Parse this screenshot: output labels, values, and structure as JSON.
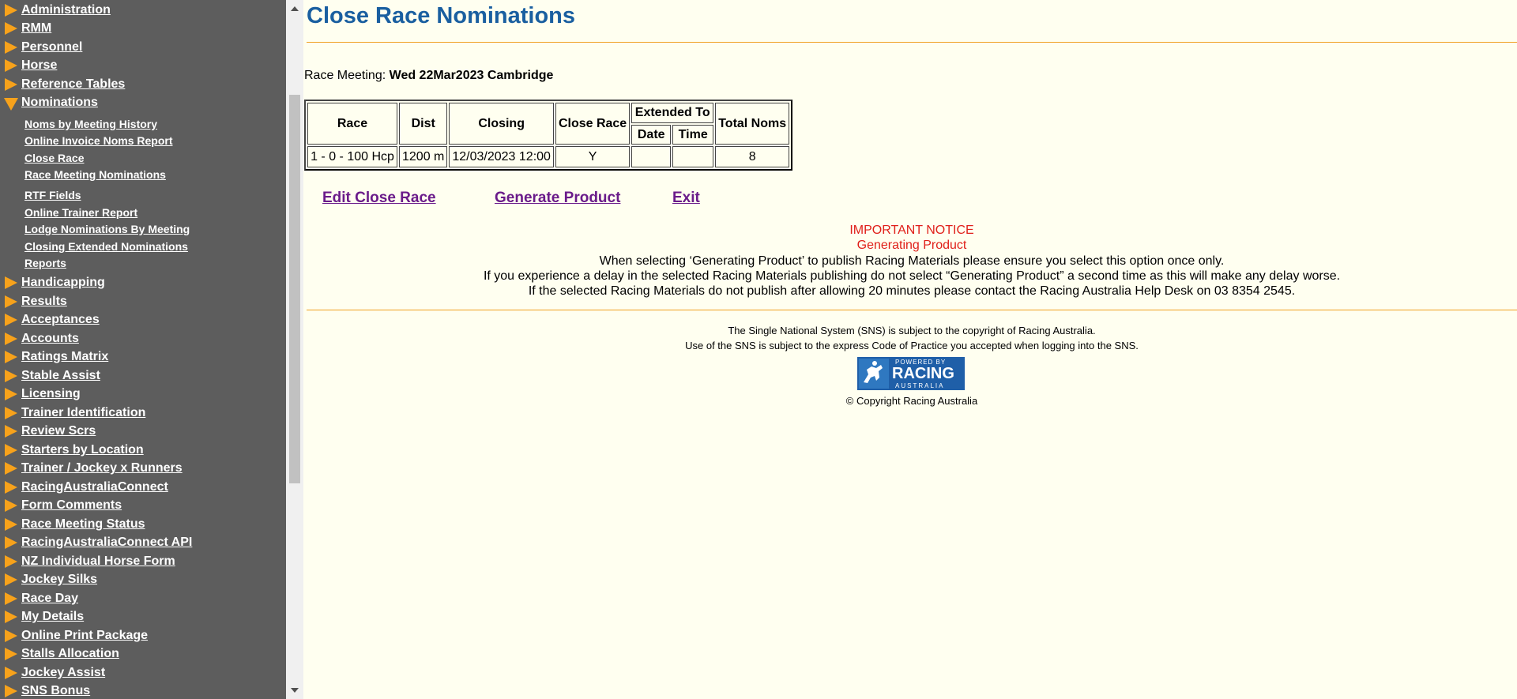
{
  "sidebar": {
    "items": [
      {
        "label": "Administration"
      },
      {
        "label": "RMM"
      },
      {
        "label": "Personnel"
      },
      {
        "label": "Horse"
      },
      {
        "label": "Reference Tables"
      },
      {
        "label": "Nominations"
      },
      {
        "label": "Handicapping"
      },
      {
        "label": "Results"
      },
      {
        "label": "Acceptances"
      },
      {
        "label": "Accounts"
      },
      {
        "label": "Ratings Matrix"
      },
      {
        "label": "Stable Assist"
      },
      {
        "label": "Licensing"
      },
      {
        "label": "Trainer Identification"
      },
      {
        "label": "Review Scrs"
      },
      {
        "label": "Starters by Location"
      },
      {
        "label": "Trainer / Jockey x Runners"
      },
      {
        "label": "RacingAustraliaConnect"
      },
      {
        "label": "Form Comments"
      },
      {
        "label": "Race Meeting Status"
      },
      {
        "label": "RacingAustraliaConnect API"
      },
      {
        "label": "NZ Individual Horse Form"
      },
      {
        "label": "Jockey Silks"
      },
      {
        "label": "Race Day"
      },
      {
        "label": "My Details"
      },
      {
        "label": "Online Print Package"
      },
      {
        "label": "Stalls Allocation"
      },
      {
        "label": "Jockey Assist"
      },
      {
        "label": "SNS Bonus"
      }
    ],
    "subitems": [
      {
        "label": "Noms by Meeting History"
      },
      {
        "label": "Online Invoice Noms Report"
      },
      {
        "label": "Close Race"
      },
      {
        "label": "Race Meeting Nominations"
      },
      {
        "label": "RTF Fields"
      },
      {
        "label": "Online Trainer Report"
      },
      {
        "label": "Lodge Nominations By Meeting"
      },
      {
        "label": "Closing Extended Nominations"
      },
      {
        "label": "Reports"
      }
    ]
  },
  "main": {
    "title": "Close Race Nominations",
    "meeting_label": "Race Meeting:",
    "meeting_value": "Wed 22Mar2023 Cambridge",
    "table": {
      "headers": {
        "race": "Race",
        "dist": "Dist",
        "closing": "Closing",
        "close_race": "Close Race",
        "extended_to": "Extended To",
        "date": "Date",
        "time": "Time",
        "total_noms": "Total Noms"
      },
      "rows": [
        {
          "race": "1 - 0 - 100 Hcp",
          "dist": "1200 m",
          "closing": "12/03/2023 12:00",
          "close_race": "Y",
          "date": "",
          "time": "",
          "total_noms": "8"
        }
      ]
    },
    "actions": {
      "edit": "Edit Close Race",
      "generate": "Generate Product",
      "exit": "Exit"
    },
    "notice": {
      "heading": "IMPORTANT NOTICE",
      "subheading": "Generating Product",
      "line1": "When selecting ‘Generating Product’ to publish Racing Materials please ensure you select this option once only.",
      "line2": "If you experience a delay in the selected Racing Materials publishing do not select “Generating Product” a second time as this will make any delay worse.",
      "line3": "If the selected Racing Materials do not publish after allowing 20 minutes please contact the Racing Australia Help Desk on 03 8354 2545."
    },
    "footer": {
      "line1": "The Single National System (SNS) is subject to the copyright of Racing Australia.",
      "line2": "Use of the SNS is subject to the express Code of Practice you accepted when logging into the SNS.",
      "logo_powered": "POWERED BY",
      "logo_racing": "RACING",
      "logo_australia": "AUSTRALIA",
      "copyright": "© Copyright Racing Australia"
    }
  },
  "colors": {
    "sidebar_bg": "#5d5d5d",
    "arrow": "#f7a21b",
    "title": "#1a5fa0",
    "link": "#6a1b8a",
    "notice": "#e0201a",
    "page_bg": "#fffff0"
  }
}
